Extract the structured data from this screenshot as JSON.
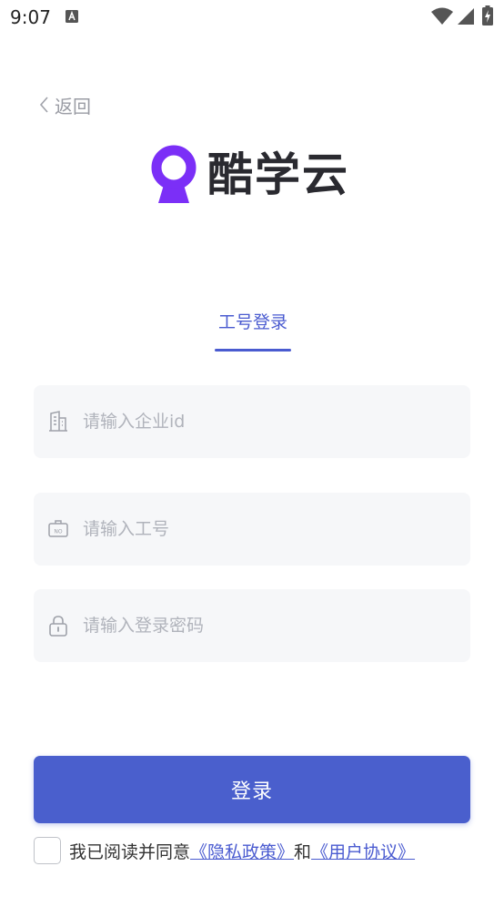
{
  "status_bar": {
    "time": "9:07"
  },
  "header": {
    "back_label": "返回"
  },
  "logo": {
    "brand_name": "酷学云",
    "accent_color": "#7b2ff7"
  },
  "tabs": [
    {
      "label": "工号登录",
      "active": true
    }
  ],
  "form": {
    "company_id": {
      "placeholder": "请输入企业id",
      "value": "",
      "icon": "building-icon"
    },
    "employee_no": {
      "placeholder": "请输入工号",
      "value": "",
      "icon": "badge-icon"
    },
    "password": {
      "placeholder": "请输入登录密码",
      "value": "",
      "icon": "lock-icon"
    }
  },
  "login_button": {
    "label": "登录",
    "color": "#4a5fcd"
  },
  "agreement": {
    "checked": false,
    "text_before": "我已阅读并同意",
    "privacy_link": "《隐私政策》",
    "joiner": "和",
    "user_agreement_link": "《用户协议》"
  }
}
